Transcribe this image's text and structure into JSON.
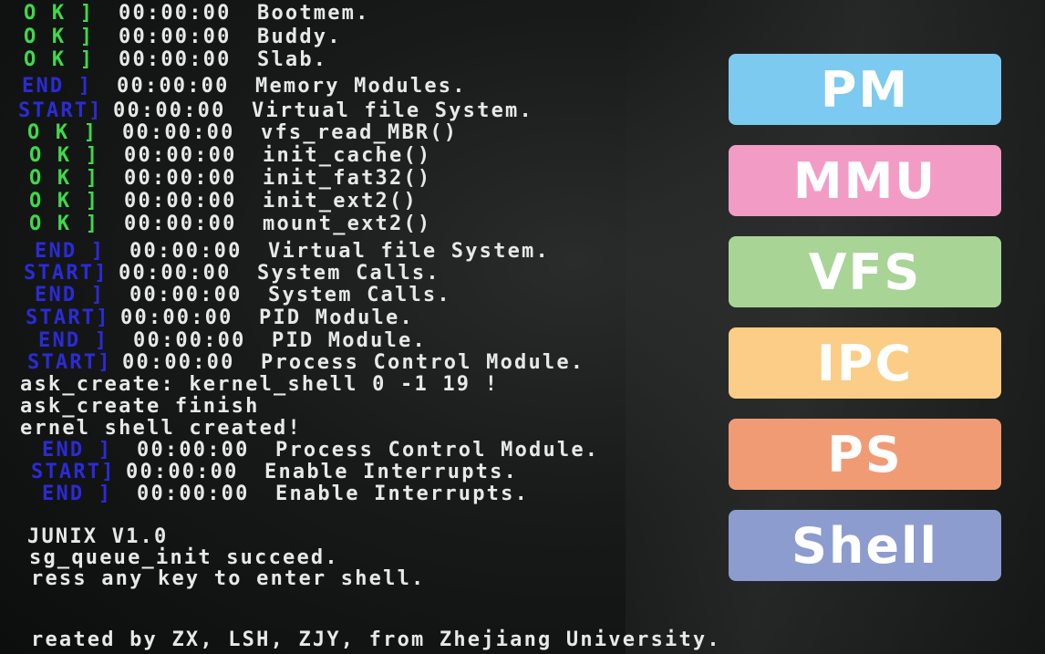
{
  "terminal": {
    "lines": [
      {
        "status": "O K ]",
        "status_type": "ok",
        "time": "00:00:00",
        "msg": "Bootmem."
      },
      {
        "status": "O K ]",
        "status_type": "ok",
        "time": "00:00:00",
        "msg": "Buddy."
      },
      {
        "status": "O K ]",
        "status_type": "ok",
        "time": "00:00:00",
        "msg": "Slab."
      },
      {
        "status": "END ]",
        "status_type": "info",
        "time": "00:00:00",
        "msg": "Memory Modules."
      },
      {
        "status": "START]",
        "status_type": "info",
        "time": "00:00:00",
        "msg": "Virtual file System."
      },
      {
        "status": "O K ]",
        "status_type": "ok",
        "time": "00:00:00",
        "msg": "vfs_read_MBR()"
      },
      {
        "status": "O K ]",
        "status_type": "ok",
        "time": "00:00:00",
        "msg": "init_cache()"
      },
      {
        "status": "O K ]",
        "status_type": "ok",
        "time": "00:00:00",
        "msg": "init_fat32()"
      },
      {
        "status": "O K ]",
        "status_type": "ok",
        "time": "00:00:00",
        "msg": "init_ext2()"
      },
      {
        "status": "O K ]",
        "status_type": "ok",
        "time": "00:00:00",
        "msg": "mount_ext2()"
      },
      {
        "status": "END ]",
        "status_type": "info",
        "time": "00:00:00",
        "msg": "Virtual file System."
      },
      {
        "status": "START]",
        "status_type": "info",
        "time": "00:00:00",
        "msg": "System Calls."
      },
      {
        "status": "END ]",
        "status_type": "info",
        "time": "00:00:00",
        "msg": "System Calls."
      },
      {
        "status": "START]",
        "status_type": "info",
        "time": "00:00:00",
        "msg": "PID Module."
      },
      {
        "status": "END ]",
        "status_type": "info",
        "time": "00:00:00",
        "msg": "PID Module."
      },
      {
        "status": "START]",
        "status_type": "info",
        "time": "00:00:00",
        "msg": "Process Control Module."
      },
      {
        "plain": "ask_create: kernel_shell 0 -1 19 !"
      },
      {
        "plain": "ask_create finish"
      },
      {
        "plain": "ernel shell created!"
      },
      {
        "status": "END ]",
        "status_type": "info",
        "time": "00:00:00",
        "msg": "Process Control Module."
      },
      {
        "status": "START]",
        "status_type": "info",
        "time": "00:00:00",
        "msg": "Enable Interrupts."
      },
      {
        "status": "END ]",
        "status_type": "info",
        "time": "00:00:00",
        "msg": "Enable Interrupts."
      },
      {
        "plain": ""
      },
      {
        "plain": "JUNIX V1.0"
      },
      {
        "plain": "sg_queue_init succeed."
      },
      {
        "plain": "ress any key to enter shell."
      },
      {
        "plain": ""
      },
      {
        "plain": "reated by ZX, LSH, ZJY, from Zhejiang University."
      }
    ]
  },
  "legend": {
    "items": [
      {
        "label": "PM",
        "color": "#7ccaf0"
      },
      {
        "label": "MMU",
        "color": "#f29cc5"
      },
      {
        "label": "VFS",
        "color": "#a8d496"
      },
      {
        "label": "IPC",
        "color": "#fbcd86"
      },
      {
        "label": "PS",
        "color": "#f19b75"
      },
      {
        "label": "Shell",
        "color": "#8d9ccf"
      }
    ]
  }
}
